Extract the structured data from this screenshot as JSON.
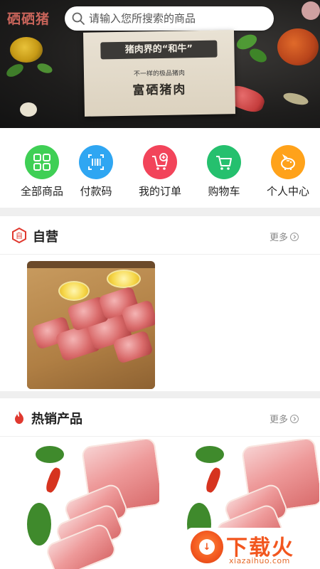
{
  "banner": {
    "brand": "硒硒猪",
    "search_placeholder": "请输入您所搜索的商品",
    "board_ribbon": "猪肉界的“和牛”",
    "board_subtitle": "不一样的极品猪肉",
    "board_title": "富硒猪肉"
  },
  "menu": {
    "items": [
      {
        "label": "全部商品",
        "icon": "grid-icon",
        "color": "#3fcf55"
      },
      {
        "label": "付款码",
        "icon": "barcode-icon",
        "color": "#2fa6f2"
      },
      {
        "label": "我的订单",
        "icon": "cart-add-icon",
        "color": "#f2445a"
      },
      {
        "label": "购物车",
        "icon": "cart-icon",
        "color": "#25c06e"
      },
      {
        "label": "个人中心",
        "icon": "piggy-bank-icon",
        "color": "#ffa21a"
      }
    ]
  },
  "sections": {
    "self": {
      "title": "自营",
      "icon_char": "自",
      "more": "更多"
    },
    "hot": {
      "title": "热销产品",
      "more": "更多"
    }
  },
  "watermark": {
    "big": "下载火",
    "small": "xiazaihuo.com"
  },
  "colors": {
    "accent_red": "#e0392f",
    "bg_gap": "#efefef"
  }
}
